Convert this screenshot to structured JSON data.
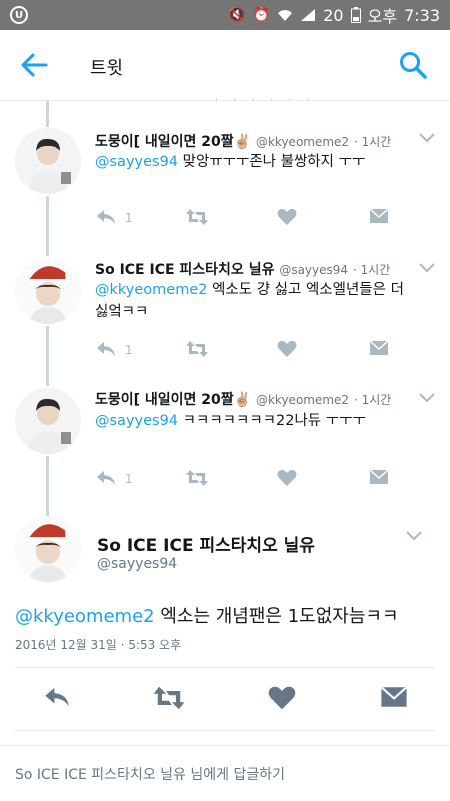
{
  "status_bar": {
    "app_icon": "U",
    "battery": "20",
    "ampm": "오후",
    "time": "7:33",
    "icons": [
      "mute-icon",
      "alarm-icon",
      "wifi-icon",
      "signal-icon",
      "battery-icon"
    ]
  },
  "header": {
    "title": "트윗",
    "back_icon": "arrow-left-icon",
    "search_icon": "search-icon"
  },
  "accent": "#1da1f2",
  "thread": [
    {
      "name": "도뭉이[ 내일이면 20짤✌🏼",
      "handle": "@kkyeomeme2",
      "time": "· 1시간",
      "mention": "@sayyes94",
      "text": " 맞앙ㅠㅜㅜ존나 불쌍하지 ㅜㅜ",
      "reply_count": "1"
    },
    {
      "name": "So ICE ICE 피스타치오 닐유",
      "handle": "@sayyes94",
      "time": "· 1시간",
      "mention": "@kkyeomeme2",
      "text": " 엑소도 걍 싫고 엑소엘년들은 더 싫엌ㅋㅋ",
      "reply_count": "1"
    },
    {
      "name": "도뭉이[ 내일이면 20짤✌🏼",
      "handle": "@kkyeomeme2",
      "time": "· 1시간",
      "mention": "@sayyes94",
      "text": " ㅋㅋㅋㅋㅋㅋㅋ22나듀 ㅜㅜㅜ",
      "reply_count": "1"
    }
  ],
  "main_tweet": {
    "name": "So ICE ICE 피스타치오 닐유",
    "handle": "@sayyes94",
    "mention": "@kkyeomeme2",
    "text": " 엑소는 개념팬은 1도없자늠ㅋㅋ",
    "date": "2016년 12월 31일 · 5:53 오후"
  },
  "reply_box": {
    "placeholder": "So ICE ICE 피스타치오 닐유 님에게 답글하기"
  }
}
